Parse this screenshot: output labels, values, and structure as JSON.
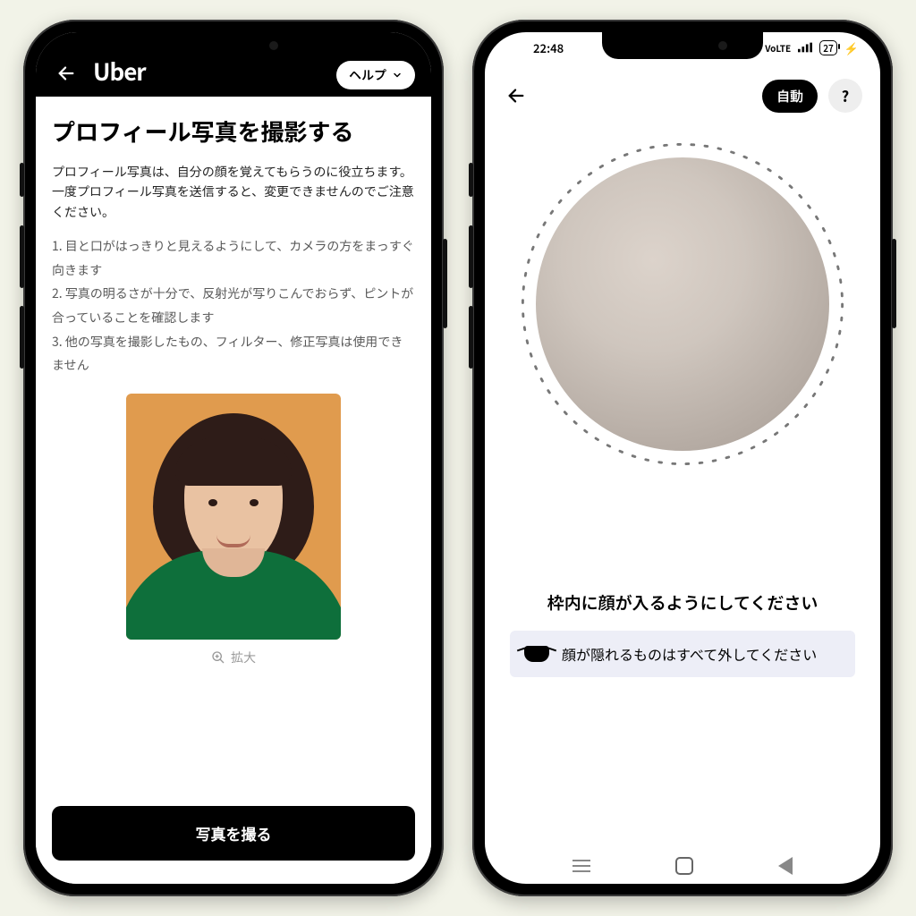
{
  "left": {
    "logo": "Uber",
    "help_label": "ヘルプ",
    "title": "プロフィール写真を撮影する",
    "description": "プロフィール写真は、自分の顔を覚えてもらうのに役立ちます。一度プロフィール写真を送信すると、変更できませんのでご注意ください。",
    "steps": [
      "1. 目と口がはっきりと見えるようにして、カメラの方をまっすぐ向きます",
      "2. 写真の明るさが十分で、反射光が写りこんでおらず、ピントが合っていることを確認します",
      "3. 他の写真を撮影したもの、フィルター、修正写真は使用できません"
    ],
    "zoom_label": "拡大",
    "cta_label": "写真を撮る"
  },
  "right": {
    "status_time": "22:48",
    "status_battery": "27",
    "auto_label": "自動",
    "help_mark": "?",
    "instruction_title": "枠内に顔が入るようにしてください",
    "tip_text": "顔が隠れるものはすべて外してください"
  }
}
